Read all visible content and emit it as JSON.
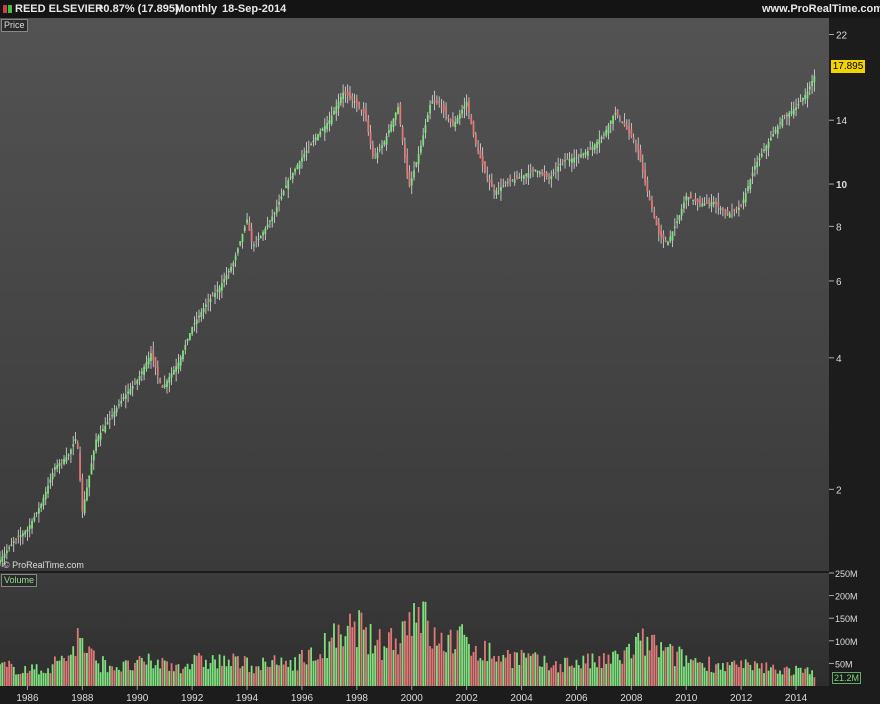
{
  "header": {
    "symbol": "REED ELSEVIER",
    "change": "+0.87% (17.895)",
    "period": "Monthly",
    "date": "18-Sep-2014",
    "site": "www.ProRealTime.com"
  },
  "colors": {
    "up": "#7fe07f",
    "down": "#e07878",
    "wick": "#dddddd",
    "last_label_bg": "#f2d400"
  },
  "price_panel": {
    "label": "Price",
    "last_value_label": "17.895",
    "watermark": "© ProRealTime.com"
  },
  "volume_panel": {
    "label": "Volume",
    "last_value_label": "21.2M"
  },
  "chart_data": [
    {
      "type": "line",
      "panel": "price",
      "y_scale": "log",
      "ylim": [
        1.3,
        24
      ],
      "xlim": [
        1985.0,
        2015.2
      ],
      "y_ticks": [
        2,
        4,
        6,
        8,
        10,
        14,
        22
      ],
      "y_tick_labels": [
        "2",
        "4",
        "6",
        "8",
        "10",
        "14",
        "22"
      ],
      "x_ticks": [
        1986,
        1988,
        1990,
        1992,
        1994,
        1996,
        1998,
        2000,
        2002,
        2004,
        2006,
        2008,
        2010,
        2012,
        2014
      ],
      "x_tick_labels": [
        "1986",
        "1988",
        "1990",
        "1992",
        "1994",
        "1996",
        "1998",
        "2000",
        "2002",
        "2004",
        "2006",
        "2008",
        "2010",
        "2012",
        "2014"
      ],
      "last_value": 17.895,
      "x": [
        1985.0,
        1985.5,
        1986.0,
        1986.5,
        1987.0,
        1987.5,
        1987.8,
        1988.0,
        1988.5,
        1989.0,
        1989.5,
        1990.0,
        1990.5,
        1990.9,
        1991.5,
        1992.0,
        1992.5,
        1993.0,
        1993.5,
        1994.0,
        1994.2,
        1994.5,
        1995.0,
        1995.5,
        1996.0,
        1996.5,
        1997.0,
        1997.5,
        1997.9,
        1998.3,
        1998.6,
        1999.0,
        1999.5,
        1999.9,
        2000.3,
        2000.7,
        2001.0,
        2001.5,
        2002.0,
        2002.3,
        2002.7,
        2003.0,
        2003.5,
        2004.0,
        2004.5,
        2005.0,
        2005.5,
        2006.0,
        2006.5,
        2007.0,
        2007.4,
        2007.8,
        2008.2,
        2008.6,
        2009.0,
        2009.3,
        2009.7,
        2010.0,
        2010.5,
        2011.0,
        2011.5,
        2012.0,
        2012.5,
        2013.0,
        2013.5,
        2014.0,
        2014.4,
        2014.7
      ],
      "values": [
        1.38,
        1.52,
        1.62,
        1.85,
        2.25,
        2.4,
        2.65,
        1.78,
        2.6,
        2.9,
        3.25,
        3.55,
        4.1,
        3.4,
        3.9,
        4.7,
        5.3,
        5.8,
        6.6,
        8.3,
        7.2,
        7.6,
        8.6,
        10.2,
        11.5,
        12.8,
        14.0,
        16.2,
        15.5,
        14.4,
        11.4,
        12.5,
        15.0,
        9.8,
        12.0,
        15.5,
        15.3,
        13.6,
        15.4,
        12.5,
        10.5,
        9.6,
        10.1,
        10.4,
        10.8,
        10.3,
        11.3,
        11.5,
        12.0,
        13.0,
        14.6,
        13.5,
        12.2,
        9.5,
        7.7,
        7.3,
        8.3,
        9.4,
        9.0,
        9.1,
        8.5,
        8.9,
        11.0,
        12.5,
        14.1,
        15.0,
        16.2,
        17.895
      ]
    },
    {
      "type": "bar",
      "panel": "volume",
      "ylim": [
        0,
        250
      ],
      "y_ticks": [
        50,
        100,
        150,
        200,
        250
      ],
      "y_tick_labels": [
        "50M",
        "100M",
        "150M",
        "200M",
        "250M"
      ],
      "last_value": 21.2,
      "x": [
        1985.5,
        1986.5,
        1987.5,
        1987.85,
        1988.5,
        1989.5,
        1990.5,
        1991.5,
        1992.5,
        1993.5,
        1994.5,
        1995.5,
        1996.5,
        1997.2,
        1997.6,
        1997.9,
        1998.3,
        1998.8,
        1999.5,
        1999.9,
        2000.2,
        2000.6,
        2001.0,
        2001.5,
        2002.0,
        2002.5,
        2003.0,
        2004.0,
        2005.0,
        2006.0,
        2007.0,
        2007.7,
        2008.5,
        2009.0,
        2009.5,
        2010.5,
        2011.5,
        2012.5,
        2013.5,
        2014.5
      ],
      "values": [
        55,
        45,
        90,
        140,
        70,
        55,
        70,
        60,
        75,
        70,
        60,
        70,
        90,
        140,
        120,
        205,
        140,
        120,
        150,
        190,
        260,
        160,
        120,
        140,
        130,
        110,
        90,
        85,
        60,
        70,
        70,
        90,
        130,
        110,
        90,
        70,
        60,
        55,
        50,
        40
      ]
    }
  ]
}
